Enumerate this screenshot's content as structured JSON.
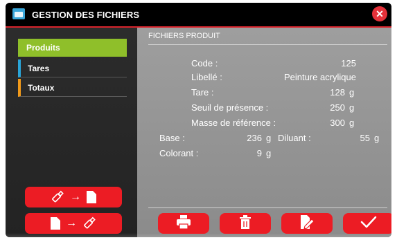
{
  "titlebar": {
    "title": "GESTION DES FICHIERS",
    "app_icon": "folder-icon",
    "close_icon": "close-icon"
  },
  "sidebar": {
    "items": [
      {
        "label": "Produits",
        "accent": "#8fbf2a",
        "active": true
      },
      {
        "label": "Tares",
        "accent": "#2aa5d8",
        "active": false
      },
      {
        "label": "Totaux",
        "accent": "#f29a1a",
        "active": false
      }
    ],
    "buttons": [
      {
        "name": "import-from-usb",
        "icons": [
          "usb-icon",
          "arrow-right-icon",
          "file-icon"
        ]
      },
      {
        "name": "export-to-usb",
        "icons": [
          "file-icon",
          "arrow-right-icon",
          "usb-icon"
        ]
      }
    ]
  },
  "main": {
    "section_title": "FICHIERS PRODUIT",
    "fields": {
      "code": {
        "label": "Code :",
        "value": "125"
      },
      "libelle": {
        "label": "Libellé :",
        "value": "Peinture acrylique"
      },
      "tare": {
        "label": "Tare :",
        "value": "128",
        "unit": "g"
      },
      "seuil": {
        "label": "Seuil de présence :",
        "value": "250",
        "unit": "g"
      },
      "masse": {
        "label": "Masse de référence :",
        "value": "300",
        "unit": "g"
      },
      "base": {
        "label": "Base :",
        "value": "236",
        "unit": "g"
      },
      "diluant": {
        "label": "Diluant :",
        "value": "55",
        "unit": "g"
      },
      "colorant": {
        "label": "Colorant :",
        "value": "9",
        "unit": "g"
      }
    },
    "actions": [
      "print-icon",
      "trash-icon",
      "edit-icon",
      "check-icon"
    ]
  },
  "colors": {
    "accent_red": "#ec1c24",
    "active_green": "#8fbf2a",
    "panel_gray": "#969696"
  }
}
